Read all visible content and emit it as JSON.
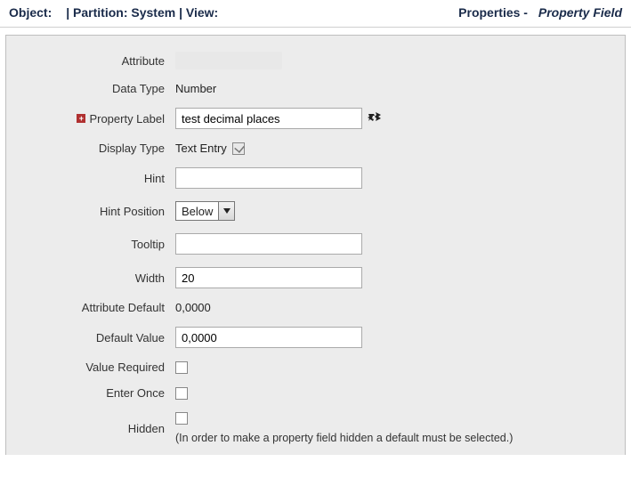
{
  "header": {
    "object_lbl": "Object:",
    "partition_lbl": "| Partition: System | View:",
    "props_lbl": "Properties -",
    "props_italic": "Property Field"
  },
  "labels": {
    "attribute": "Attribute",
    "data_type": "Data Type",
    "property_label": "Property Label",
    "display_type": "Display Type",
    "hint": "Hint",
    "hint_position": "Hint Position",
    "tooltip": "Tooltip",
    "width": "Width",
    "attribute_default": "Attribute Default",
    "default_value": "Default Value",
    "value_required": "Value Required",
    "enter_once": "Enter Once",
    "hidden": "Hidden"
  },
  "values": {
    "data_type": "Number",
    "property_label": "test decimal places",
    "display_type": "Text Entry",
    "hint": "",
    "hint_position": "Below",
    "tooltip": "",
    "width": "20",
    "attribute_default": "0,0000",
    "default_value": "0,0000"
  },
  "hidden_note": "(In order to make a property field hidden a default must be selected.)"
}
